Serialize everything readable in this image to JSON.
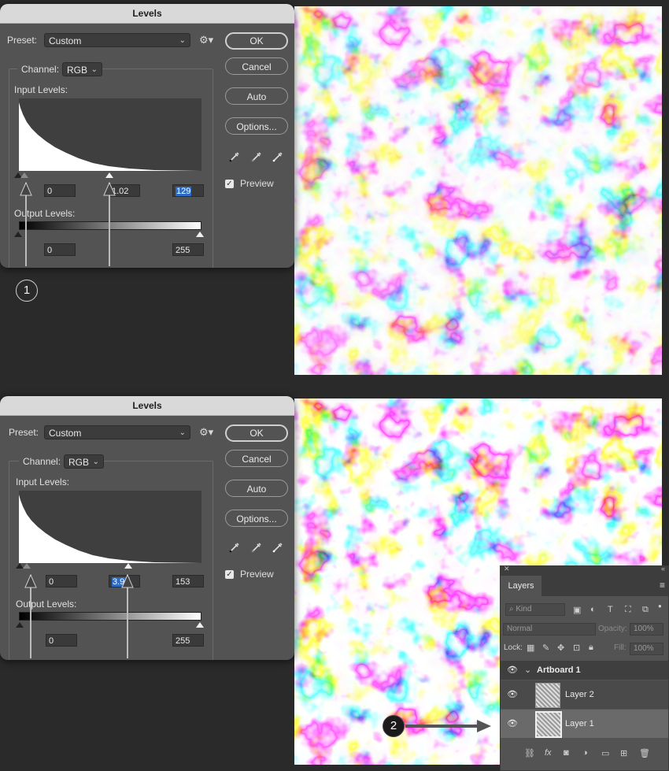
{
  "dialog_top": {
    "title": "Levels",
    "preset_label": "Preset:",
    "preset_value": "Custom",
    "channel_label": "Channel:",
    "channel_value": "RGB",
    "input_levels_label": "Input Levels:",
    "input_black": "0",
    "input_gamma": "1.02",
    "input_white": "129",
    "output_levels_label": "Output Levels:",
    "output_black": "0",
    "output_white": "255",
    "ok": "OK",
    "cancel": "Cancel",
    "auto": "Auto",
    "options": "Options...",
    "preview_label": "Preview",
    "preview_checked": true
  },
  "dialog_bottom": {
    "title": "Levels",
    "preset_label": "Preset:",
    "preset_value": "Custom",
    "channel_label": "Channel:",
    "channel_value": "RGB",
    "input_levels_label": "Input Levels:",
    "input_black": "0",
    "input_gamma": "3.91",
    "input_white": "153",
    "output_levels_label": "Output Levels:",
    "output_black": "0",
    "output_white": "255",
    "ok": "OK",
    "cancel": "Cancel",
    "auto": "Auto",
    "options": "Options...",
    "preview_label": "Preview",
    "preview_checked": true
  },
  "badges": {
    "one": "1",
    "two": "2"
  },
  "layers_panel": {
    "tab": "Layers",
    "filter_placeholder": "Kind",
    "blend_mode": "Normal",
    "opacity_label": "Opacity:",
    "opacity_value": "100%",
    "lock_label": "Lock:",
    "fill_label": "Fill:",
    "fill_value": "100%",
    "artboard_name": "Artboard 1",
    "layers": [
      {
        "name": "Layer 2",
        "selected": false
      },
      {
        "name": "Layer 1",
        "selected": true
      }
    ],
    "footer_icons": [
      "link-icon",
      "fx-icon",
      "mask-icon",
      "adjustment-icon",
      "folder-icon",
      "new-layer-icon",
      "trash-icon"
    ]
  }
}
